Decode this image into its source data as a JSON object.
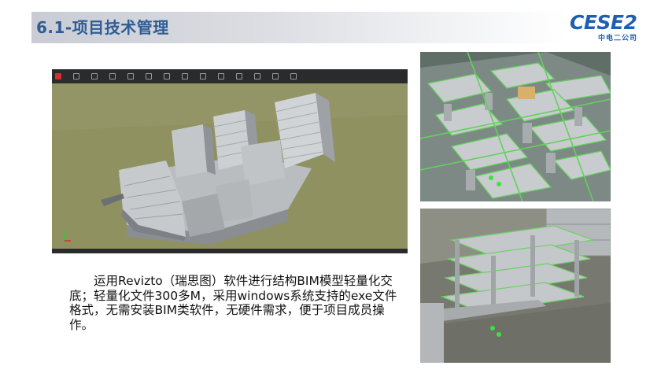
{
  "page": {
    "title": "6.1-项目技术管理",
    "accent_color": "#2f5c94",
    "band_color": "#c9ccd4"
  },
  "logo": {
    "mark": "CESE2",
    "subtitle": "中电二公司",
    "color": "#1f5fb0"
  },
  "viewer": {
    "description": "Revizto 3D viewer window showing lightweight BIM building model on olive ground plane",
    "toolbar_bg": "#2a2b2d",
    "ground_color": "#8f9161"
  },
  "renders": [
    {
      "name": "structural-floor-plan-isometric",
      "icon": "bim-render"
    },
    {
      "name": "structural-frame-closeup",
      "icon": "bim-render"
    }
  ],
  "description": {
    "text": "运用Revizto（瑞思图）软件进行结构BIM模型轻量化交底；轻量化文件300多M，采用windows系统支持的exe文件格式，无需安装BIM类软件，无硬件需求，便于项目成员操作。"
  }
}
